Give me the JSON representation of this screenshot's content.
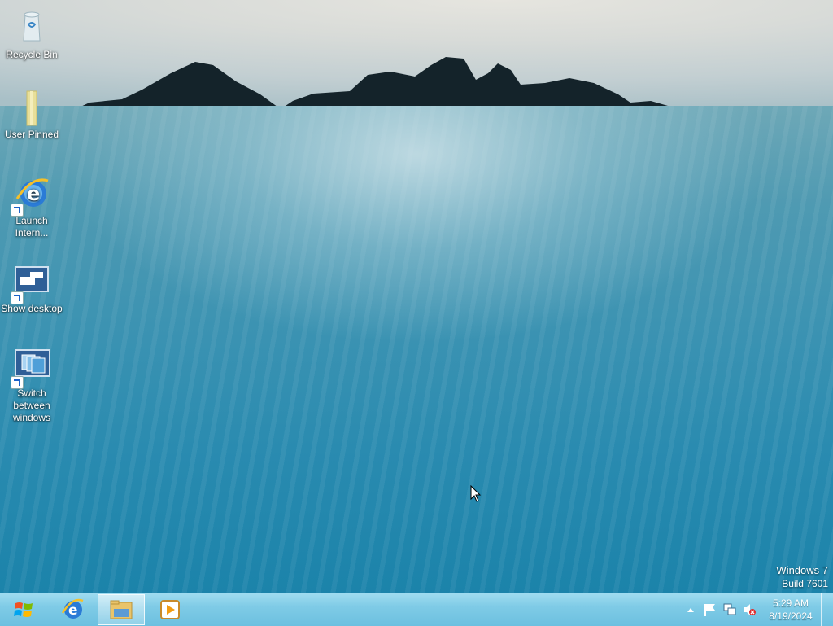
{
  "desktop": {
    "icons": [
      {
        "label": "Recycle Bin",
        "icon": "recycle-bin-icon"
      },
      {
        "label": "User Pinned",
        "icon": "folder-icon"
      },
      {
        "label": "Launch Intern...",
        "icon": "internet-explorer-icon"
      },
      {
        "label": "Show desktop",
        "icon": "show-desktop-icon"
      },
      {
        "label": "Switch between windows",
        "icon": "switch-windows-icon"
      }
    ],
    "watermark": {
      "line1": "Windows 7",
      "line2": "Build 7601"
    }
  },
  "taskbar": {
    "start": "windows-start-icon",
    "pinned": [
      {
        "icon": "internet-explorer-icon"
      },
      {
        "icon": "file-explorer-icon",
        "active": true
      },
      {
        "icon": "media-player-icon"
      }
    ],
    "tray": {
      "icons": [
        "show-hidden-icons-icon",
        "action-center-flag-icon",
        "network-icon",
        "volume-muted-icon"
      ],
      "time": "5:29 AM",
      "date": "8/19/2024"
    }
  },
  "colors": {
    "taskbar": "#7fcbe6",
    "sea": "#2a8bb0"
  }
}
